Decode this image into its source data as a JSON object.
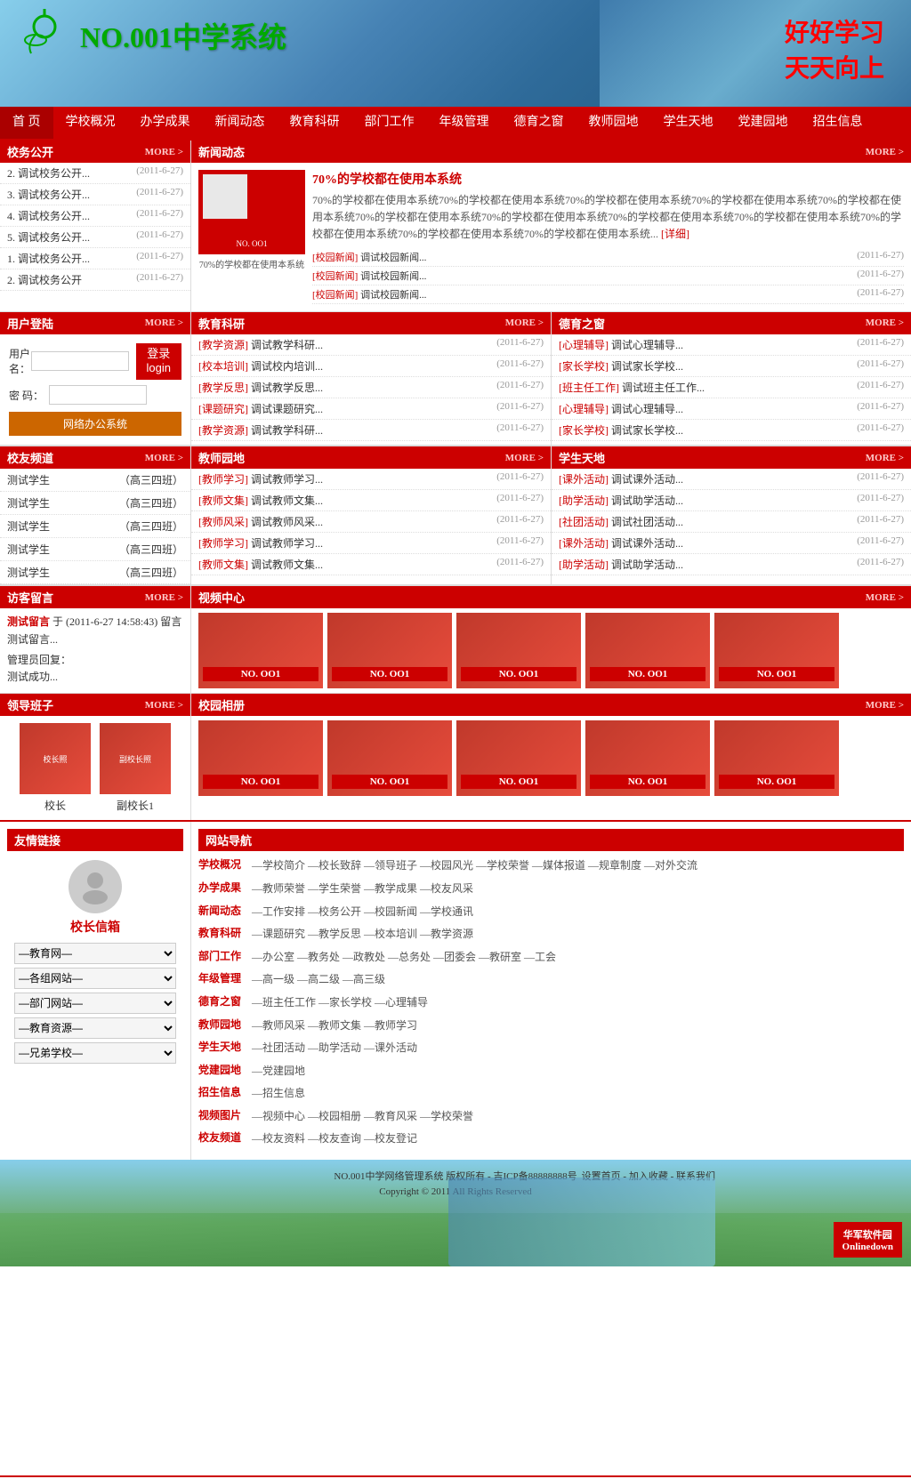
{
  "header": {
    "logo_text": "NO.001中学系统",
    "slogan_line1": "好好学习",
    "slogan_line2": "天天向上",
    "school_img_alt": "校园图片"
  },
  "nav": {
    "items": [
      "首 页",
      "学校概况",
      "办学成果",
      "新闻动态",
      "教育科研",
      "部门工作",
      "年级管理",
      "德育之窗",
      "教师园地",
      "学生天地",
      "党建园地",
      "招生信息"
    ]
  },
  "xiao_wu_gong_kai": {
    "title": "校务公开",
    "more": "MORE >",
    "items": [
      {
        "text": "2. 调试校务公开...",
        "date": "(2011-6-27)"
      },
      {
        "text": "3. 调试校务公开...",
        "date": "(2011-6-27)"
      },
      {
        "text": "4. 调试校务公开...",
        "date": "(2011-6-27)"
      },
      {
        "text": "5. 调试校务公开...",
        "date": "(2011-6-27)"
      },
      {
        "text": "1. 调试校务公开...",
        "date": "(2011-6-27)"
      },
      {
        "text": "2. 调试校务公开...",
        "date": "(2011-6-27)"
      }
    ]
  },
  "xin_wen_dong_tai": {
    "title": "新闻动态",
    "more": "MORE >",
    "img_label": "70%的学校都在使用本系统",
    "headline": "70%的学校都在使用本系统",
    "body_text": "70%的学校都在使用本系统70%的学校都在使用本系统70%的学校都在使用本系统70%的学校都在使用本系统70%的学校都在使用本系统70%的学校都在使用本系统70%的学校都在使用本系统70%的学校都在使用本系统70%的学校都在使用本系统70%的学校都在使用本系统70%的学校都在使用本系统70%的学校都在使用本系统...",
    "more_link": "[详细]",
    "sub_items": [
      {
        "tag": "[校园新闻]",
        "text": "调试校园新闻...",
        "date": "(2011-6-27)"
      },
      {
        "tag": "[校园新闻]",
        "text": "调试校园新闻...",
        "date": "(2011-6-27)"
      },
      {
        "tag": "[校园新闻]",
        "text": "调试校园新闻...",
        "date": "(2011-6-27)"
      }
    ]
  },
  "user_login": {
    "title": "用户登陆",
    "more": "MORE >",
    "username_label": "用户名：",
    "password_label": "密 码：",
    "login_btn": "登录\nlogin",
    "oa_btn": "网络办公系统"
  },
  "jiao_yu_ke_yan": {
    "title": "教育科研",
    "more": "MORE >",
    "items": [
      {
        "tag": "[教学资源]",
        "text": "调试教学科研...",
        "date": "(2011-6-27)"
      },
      {
        "tag": "[校本培训]",
        "text": "调试校内培训...",
        "date": "(2011-6-27)"
      },
      {
        "tag": "[教学反思]",
        "text": "调试教学反思...",
        "date": "(2011-6-27)"
      },
      {
        "tag": "[课题研究]",
        "text": "调试课题研究...",
        "date": "(2011-6-27)"
      },
      {
        "tag": "[教学资源]",
        "text": "调试教学科研...",
        "date": "(2011-6-27)"
      }
    ]
  },
  "de_yu_zhi_chuang": {
    "title": "德育之窗",
    "more": "MORE >",
    "items": [
      {
        "tag": "[心理辅导]",
        "text": "调试心理辅导...",
        "date": "(2011-6-27)"
      },
      {
        "tag": "[家长学校]",
        "text": "调试家长学校...",
        "date": "(2011-6-27)"
      },
      {
        "tag": "[班主任工作]",
        "text": "调试班主任工作...",
        "date": "(2011-6-27)"
      },
      {
        "tag": "[心理辅导]",
        "text": "调试心理辅导...",
        "date": "(2011-6-27)"
      },
      {
        "tag": "[家长学校]",
        "text": "调试家长学校...",
        "date": "(2011-6-27)"
      }
    ]
  },
  "xiao_you_pin_dao": {
    "title": "校友频道",
    "more": "MORE >",
    "items": [
      {
        "name": "测试学生",
        "class": "（高三四班）"
      },
      {
        "name": "测试学生",
        "class": "（高三四班）"
      },
      {
        "name": "测试学生",
        "class": "（高三四班）"
      },
      {
        "name": "测试学生",
        "class": "（高三四班）"
      },
      {
        "name": "测试学生",
        "class": "（高三四班）"
      }
    ]
  },
  "jiao_shi_yuan_di": {
    "title": "教师园地",
    "more": "MORE >",
    "items": [
      {
        "tag": "[教师学习]",
        "text": "调试教师学习...",
        "date": "(2011-6-27)"
      },
      {
        "tag": "[教师文集]",
        "text": "调试教师文集...",
        "date": "(2011-6-27)"
      },
      {
        "tag": "[教师风采]",
        "text": "调试教师风采...",
        "date": "(2011-6-27)"
      },
      {
        "tag": "[教师学习]",
        "text": "调试教师学习...",
        "date": "(2011-6-27)"
      },
      {
        "tag": "[教师文集]",
        "text": "调试教师文集...",
        "date": "(2011-6-27)"
      }
    ]
  },
  "xue_sheng_tian_di": {
    "title": "学生天地",
    "more": "MORE >",
    "items": [
      {
        "tag": "[课外活动]",
        "text": "调试课外活动...",
        "date": "(2011-6-27)"
      },
      {
        "tag": "[助学活动]",
        "text": "调试助学活动...",
        "date": "(2011-6-27)"
      },
      {
        "tag": "[社团活动]",
        "text": "调试社团活动...",
        "date": "(2011-6-27)"
      },
      {
        "tag": "[课外活动]",
        "text": "调试课外活动...",
        "date": "(2011-6-27)"
      },
      {
        "tag": "[助学活动]",
        "text": "调试助学活动...",
        "date": "(2011-6-27)"
      }
    ]
  },
  "fang_ke_liu_yan": {
    "title": "访客留言",
    "more": "MORE >",
    "msg_author": "测试留言",
    "msg_time": "于 (2011-6-27 14:58:43)",
    "msg_action": "留言",
    "msg_content": "测试留言...",
    "reply_label": "管理员回复：",
    "reply_content": "测试成功..."
  },
  "shi_pin_zhong_xin": {
    "title": "视频中心",
    "more": "MORE >",
    "items": [
      {
        "label": "NO. OO1"
      },
      {
        "label": "NO. OO1"
      },
      {
        "label": "NO. OO1"
      },
      {
        "label": "NO. OO1"
      },
      {
        "label": "NO. OO1"
      }
    ]
  },
  "ling_dao_ban_zi": {
    "title": "领导班子",
    "more": "MORE >",
    "members": [
      {
        "name": "校长",
        "img_label": ""
      },
      {
        "name": "副校长1",
        "img_label": ""
      }
    ]
  },
  "xiao_yuan_xiang_ce": {
    "title": "校园相册",
    "more": "MORE >",
    "items": [
      {
        "label": "NO. OO1"
      },
      {
        "label": "NO. OO1"
      },
      {
        "label": "NO. OO1"
      },
      {
        "label": "NO. OO1"
      },
      {
        "label": "NO. OO1"
      }
    ]
  },
  "you_qing_lian_jie": {
    "title": "友情链接",
    "principal_mailbox": "校长信箱",
    "selects": [
      {
        "label": "—教育网—"
      },
      {
        "label": "—各组网站—"
      },
      {
        "label": "—部门网站—"
      },
      {
        "label": "—教育资源—"
      },
      {
        "label": "—兄弟学校—"
      }
    ]
  },
  "wang_zhan_dao_hang": {
    "title": "网站导航",
    "sections": [
      {
        "key": "学校概况",
        "items": [
          "—学校简介",
          "—校长致辞",
          "—领导班子",
          "—校园风光",
          "—学校荣誉",
          "—媒体报道",
          "—规章制度",
          "—对外交流"
        ]
      },
      {
        "key": "办学成果",
        "items": [
          "—教师荣誉",
          "—学生荣誉",
          "—教学成果",
          "—校友风采"
        ]
      },
      {
        "key": "新闻动态",
        "items": [
          "—工作安排",
          "—校务公开",
          "—校园新闻",
          "—学校通讯"
        ]
      },
      {
        "key": "教育科研",
        "items": [
          "—课题研究",
          "—教学反思",
          "—校本培训",
          "—教学资源"
        ]
      },
      {
        "key": "部门工作",
        "items": [
          "—办公室",
          "—教务处",
          "—政教处",
          "—总务处",
          "—团委会",
          "—教研室",
          "—工会"
        ]
      },
      {
        "key": "年级管理",
        "items": [
          "—高一级",
          "—高二级",
          "—高三级"
        ]
      },
      {
        "key": "德育之窗",
        "items": [
          "—班主任工作",
          "—家长学校",
          "—心理辅导"
        ]
      },
      {
        "key": "教师园地",
        "items": [
          "—教师风采",
          "—教师文集",
          "—教师学习"
        ]
      },
      {
        "key": "学生天地",
        "items": [
          "—社团活动",
          "—助学活动",
          "—课外活动"
        ]
      },
      {
        "key": "党建园地",
        "items": [
          "—党建园地"
        ]
      },
      {
        "key": "招生信息",
        "items": [
          "—招生信息"
        ]
      },
      {
        "key": "视频图片",
        "items": [
          "—视频中心",
          "—校园相册",
          "—教育风采",
          "—学校荣誉"
        ]
      },
      {
        "key": "校友频道",
        "items": [
          "—校友资料",
          "—校友查询",
          "—校友登记"
        ]
      }
    ]
  },
  "footer": {
    "copyright": "NO.001中学网络管理系统 版权所有 - 吉ICP备88888888号",
    "copyright2": "Copyright © 2011 All Rights Reserved",
    "links": "设置首页 - 加入收藏 - 联系我们",
    "logo": "华军软件园\nOnlinedown"
  },
  "watermark": "NO. OO1"
}
